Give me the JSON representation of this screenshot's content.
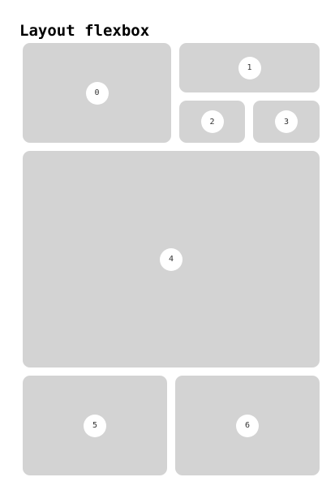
{
  "page": {
    "title": "Layout flexbox"
  },
  "colors": {
    "box_background": "#d3d3d3",
    "badge_background": "#ffffff",
    "title_text": "#000000"
  },
  "boxes": [
    {
      "label": "0"
    },
    {
      "label": "1"
    },
    {
      "label": "2"
    },
    {
      "label": "3"
    },
    {
      "label": "4"
    },
    {
      "label": "5"
    },
    {
      "label": "6"
    }
  ]
}
